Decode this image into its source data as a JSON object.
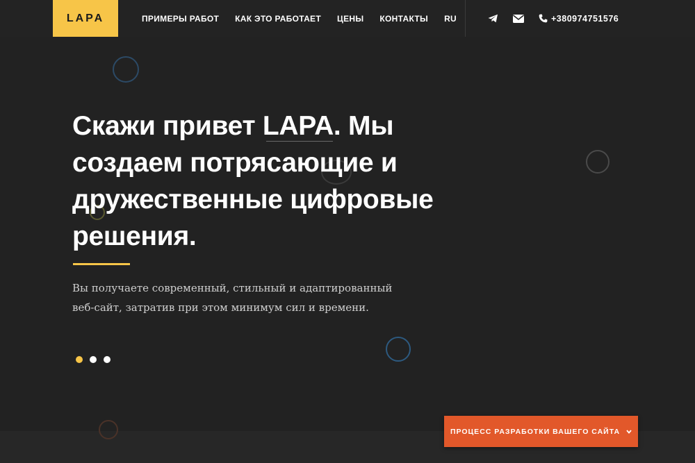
{
  "header": {
    "logo": "LAPA",
    "nav": [
      "ПРИМЕРЫ РАБОТ",
      "КАК ЭТО РАБОТАЕТ",
      "ЦЕНЫ",
      "КОНТАКТЫ",
      "RU"
    ],
    "phone": "+380974751576",
    "icons": [
      "telegram-icon",
      "envelope-icon",
      "phone-icon"
    ]
  },
  "hero": {
    "title": "Скажи привет LAPA. Мы создаем потрясающие и дружественные цифровые решения.",
    "subtitle": "Вы получаете современный, стильный и адаптированный веб-сайт, затратив при этом минимум сил и времени.",
    "slides_count": 3,
    "active_slide": 1
  },
  "cta": {
    "label": "ПРОЦЕСС РАЗРАБОТКИ ВАШЕГО САЙТА"
  },
  "colors": {
    "background": "#222222",
    "accent": "#f7c548",
    "cta": "#e2582a",
    "circle_blue": "#2c4a66",
    "circle_gray": "#4a4a4a",
    "circle_olive": "#5a5a30",
    "circle_brown": "#4a3228"
  }
}
